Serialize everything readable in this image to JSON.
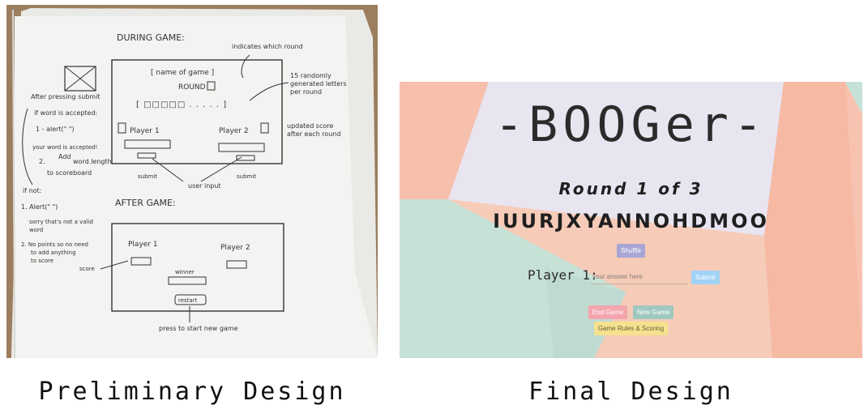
{
  "captions": {
    "left": "Preliminary Design",
    "right": "Final Design"
  },
  "sketch": {
    "during_title": "DURING GAME:",
    "indicates_note": "indicates which round",
    "name_of_game": "[ name of game ]",
    "round_label": "ROUND",
    "letters_box": "[ □□□□□ . . . . . ]",
    "random_note_1": "15 randomly",
    "random_note_2": "generated letters",
    "random_note_3": "per round",
    "player1": "Player 1",
    "player2": "Player 2",
    "score_note_1": "updated score",
    "score_note_2": "after each round",
    "submit_left": "submit",
    "submit_right": "submit",
    "user_input": "user input",
    "word_length": "word.length",
    "after_pressing": "After pressing submit",
    "if_accepted": "if word is accepted:",
    "alert_1": "1 - alert(\"         \")",
    "accepted_msg_1": "your word is accepted!",
    "add_label": "Add",
    "step_2": "2.",
    "to_scoreboard": "to scoreboard",
    "if_not": "if not:",
    "alert_2": "1. Alert(\"         \")",
    "sorry_1": "sorry that's not a valid",
    "sorry_2": "word",
    "no_points_1": "2. No points so no need",
    "no_points_2": "to add anything",
    "no_points_3": "to score",
    "after_title": "AFTER GAME:",
    "after_player1": "Player 1",
    "after_player2": "Player 2",
    "score_label": "score",
    "winner_label": "winner",
    "restart": "restart",
    "restart_note": "press to start new game"
  },
  "final": {
    "game_title": "-BOOGer-",
    "round_label": "Round 1 of 3",
    "letters": "IUURJXYANNOHDMOO",
    "shuffle_label": "Shuffle",
    "player_label": "Player 1:",
    "answer_placeholder": "your answer here",
    "submit_label": "Submit",
    "end_game_label": "End Game",
    "new_game_label": "New Game",
    "rules_label": "Game Rules & Scoring"
  }
}
